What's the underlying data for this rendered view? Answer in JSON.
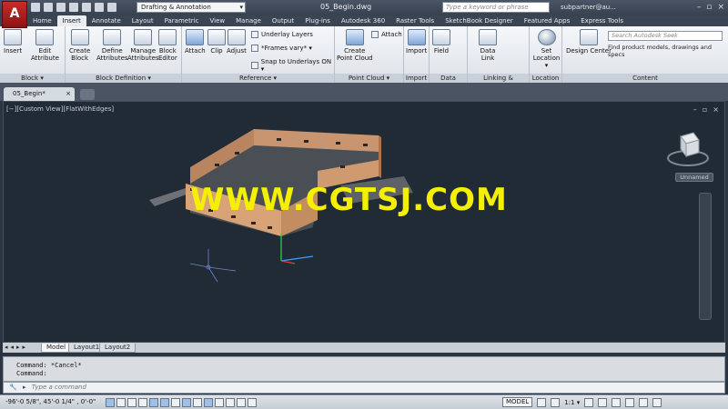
{
  "app": {
    "logo": "A",
    "workspace": "Drafting & Annotation",
    "document_title": "05_Begin.dwg",
    "search_placeholder": "Type a keyword or phrase",
    "user": "subpartner@au...",
    "colors": {
      "viewport_bg": "#212b35",
      "accent_red": "#c92a2a",
      "model": "#d49a6a",
      "watermark": "#f5f000"
    }
  },
  "ribbon_tabs": [
    "Home",
    "Insert",
    "Annotate",
    "Layout",
    "Parametric",
    "View",
    "Manage",
    "Output",
    "Plug-ins",
    "Autodesk 360",
    "Raster Tools",
    "SketchBook Designer",
    "Featured Apps",
    "Express Tools"
  ],
  "panels": {
    "block": {
      "title": "Block ▾",
      "insert": "Insert",
      "edit1": "Edit",
      "edit2": "Attribute"
    },
    "block_def": {
      "title": "Block Definition ▾",
      "create1": "Create",
      "create2": "Block",
      "define1": "Define",
      "define2": "Attributes",
      "manage1": "Manage",
      "manage2": "Attributes",
      "editor1": "Block",
      "editor2": "Editor"
    },
    "reference": {
      "title": "Reference ▾",
      "attach": "Attach",
      "clip": "Clip",
      "adjust": "Adjust",
      "underlay": "Underlay Layers",
      "frames": "*Frames vary* ▾",
      "snap": "Snap to Underlays ON ▾"
    },
    "pointcloud": {
      "title": "Point Cloud ▾",
      "create1": "Create",
      "create2": "Point Cloud",
      "attach": "Attach"
    },
    "import": {
      "title": "Import",
      "label": "Import"
    },
    "data": {
      "title": "Data",
      "field": "Field"
    },
    "linking": {
      "title": "Linking & Extraction",
      "data1": "Data",
      "data2": "Link"
    },
    "location": {
      "title": "Location",
      "set1": "Set",
      "set2": "Location ▾"
    },
    "content": {
      "title": "Content",
      "design_center": "Design Center",
      "seek_placeholder": "Search Autodesk Seek",
      "seek_desc": "Find product models, drawings and specs"
    }
  },
  "file_tab": {
    "label": "05_Begin*",
    "close": "×"
  },
  "viewport": {
    "label": "[−][Custom View][FlatWithEdges]",
    "viewcube_label": "Unnamed",
    "watermark": "WWW.CGTSJ.COM"
  },
  "layout_tabs": [
    "Model",
    "Layout1",
    "Layout2"
  ],
  "command": {
    "line1": "Command: *Cancel*",
    "line2": "Command:",
    "placeholder": "Type a command"
  },
  "status": {
    "coords": "-96'-0 5/8\",  45'-0 1/4\" , 0'-0\"",
    "model": "MODEL",
    "scale": "1:1 ▾"
  }
}
